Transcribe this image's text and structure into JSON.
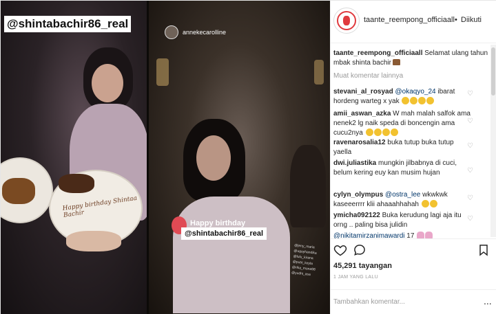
{
  "media": {
    "overlay_tag": "@shintabachir86_real",
    "plate_text": "Happy birthday Shintaa Bachir",
    "story_username": "annekecarolline",
    "story_line1": "Happy birthday",
    "story_line2": "@shintabachir86_real",
    "story_mentions": "@jeny_maria @ugoyhandika @lulu_kirana @putri_keyla @rika_mona98 @yudhi_asa"
  },
  "header": {
    "username": "taante_reempong_officiaall",
    "separator": "•",
    "follow_status": "Diikuti"
  },
  "caption": {
    "username": "taante_reempong_officiaall",
    "text": "Selamat ulang tahun mbak shinta bachir"
  },
  "load_more": "Muat komentar lainnya",
  "comments": [
    {
      "user": "stevani_al_rosyad",
      "mention": "@okaqyo_24",
      "text": " ibarat hordeng warteg x yak",
      "emoji_count": 4
    },
    {
      "user": "amii_aswan_azka",
      "mention": "",
      "text": "W mah malah salfok ama nenek2 lg naik speda di boncengin ama cucu2nya",
      "emoji_count": 4
    },
    {
      "user": "ravenarosalia12",
      "mention": "",
      "text": "buka tutup buka tutup yaella",
      "emoji_count": 0
    },
    {
      "user": "dwi.juliastika",
      "mention": "",
      "text": "mungkin jilbabnya di cuci, belum kering euy kan musim hujan",
      "emoji_count": 0
    },
    {
      "user": "cylyn_olympus",
      "mention": "@ostra_lee",
      "text": " wkwkwk kaseeerrrr klii ahaaahhahah",
      "emoji_count": 2
    },
    {
      "user": "ymicha092122",
      "mention": "",
      "text": "Buka kerudung lagi aja itu orng .. paling bisa julidin",
      "emoji_count": 0
    },
    {
      "user": "",
      "mention": "@nikitamirzanimawardi",
      "text": " 17",
      "emoji_count": 2
    }
  ],
  "actions": {
    "like_icon": "heart-outline-icon",
    "comment_icon": "comment-bubble-icon",
    "save_icon": "bookmark-icon"
  },
  "views": "45,291 tayangan",
  "timestamp": "1 JAM YANG LALU",
  "add_comment": {
    "placeholder": "Tambahkan komentar...",
    "more": "..."
  }
}
